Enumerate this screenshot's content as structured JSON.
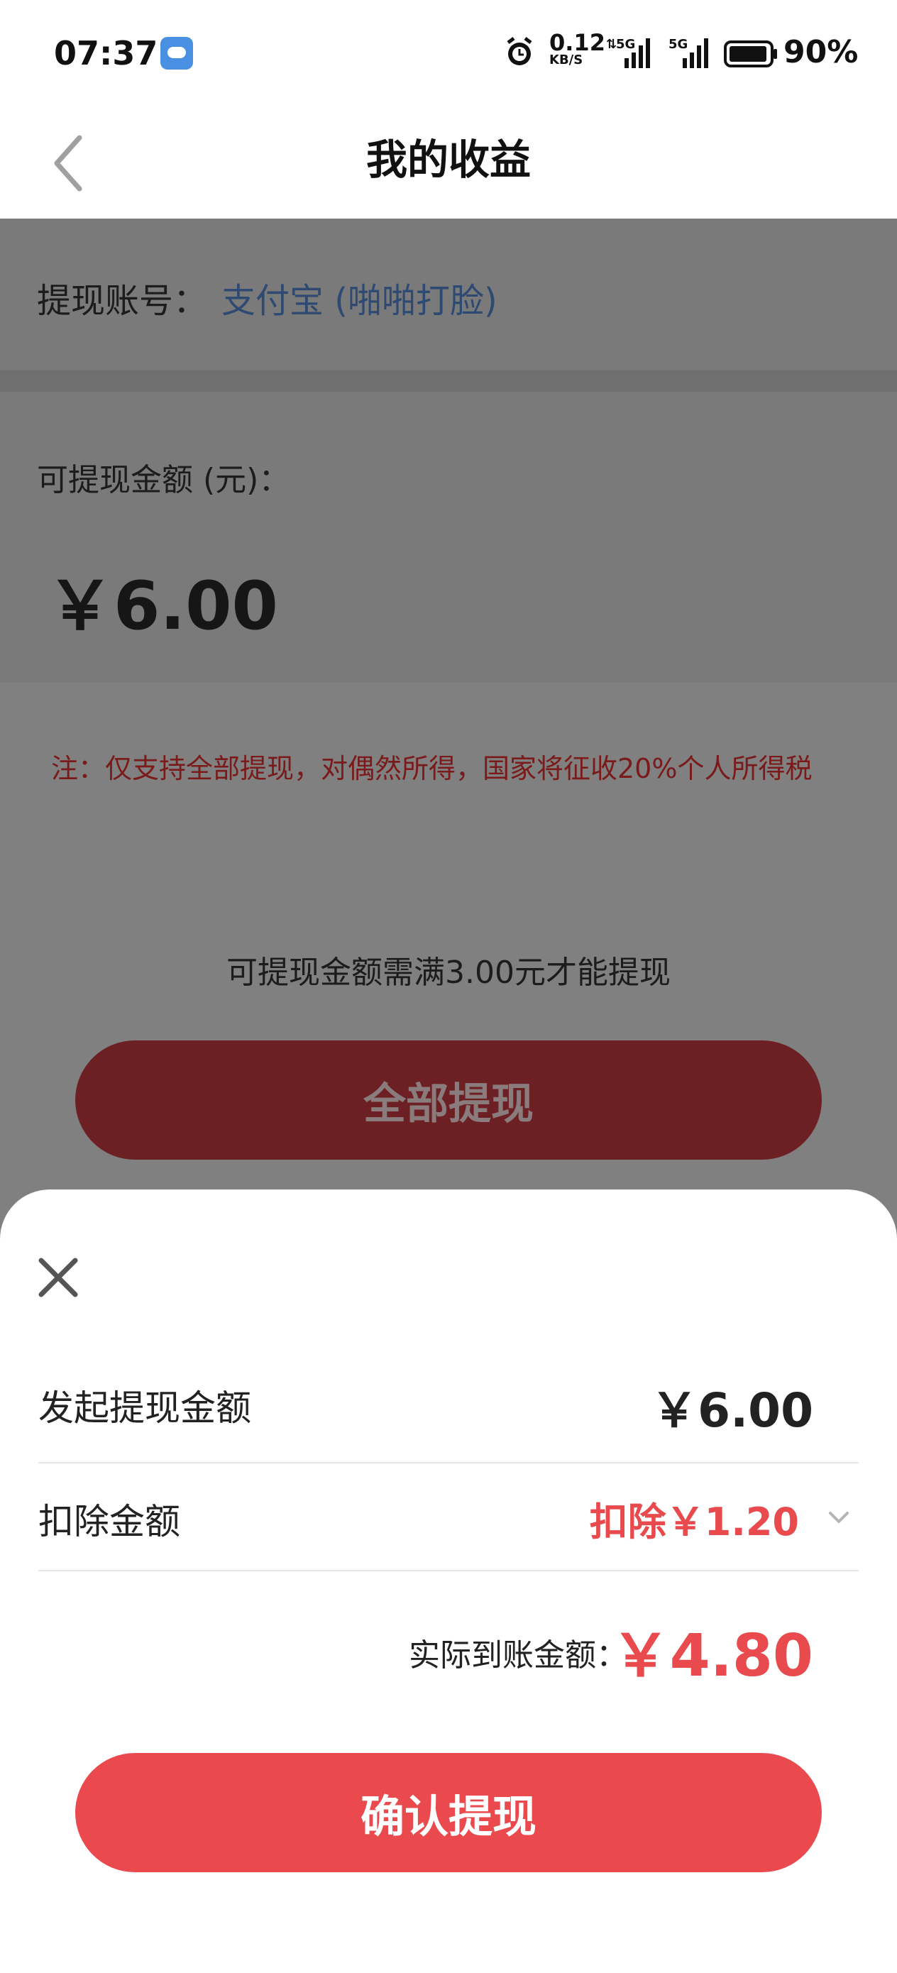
{
  "status_bar": {
    "time": "07:37",
    "net_speed_value": "0.12",
    "net_speed_unit": "KB/S",
    "signal1_label": "5G",
    "signal2_label": "5G",
    "battery": "90%"
  },
  "header": {
    "title": "我的收益"
  },
  "account": {
    "label": "提现账号：",
    "value": "支付宝 (啪啪打脸)"
  },
  "available": {
    "label": "可提现金额 (元)：",
    "amount": "￥6.00"
  },
  "note": "注：仅支持全部提现，对偶然所得，国家将征收20%个人所得税",
  "min_note": "可提现金额需满3.00元才能提现",
  "withdraw_all_label": "全部提现",
  "sheet": {
    "initiate_label": "发起提现金额",
    "initiate_value": "￥6.00",
    "deduct_label": "扣除金额",
    "deduct_value": "扣除￥1.20",
    "actual_label": "实际到账金额：",
    "actual_value": "￥4.80",
    "confirm_label": "确认提现"
  },
  "colors": {
    "accent": "#ea4a4d",
    "link": "#2f4a72",
    "overlay": "#808080"
  }
}
